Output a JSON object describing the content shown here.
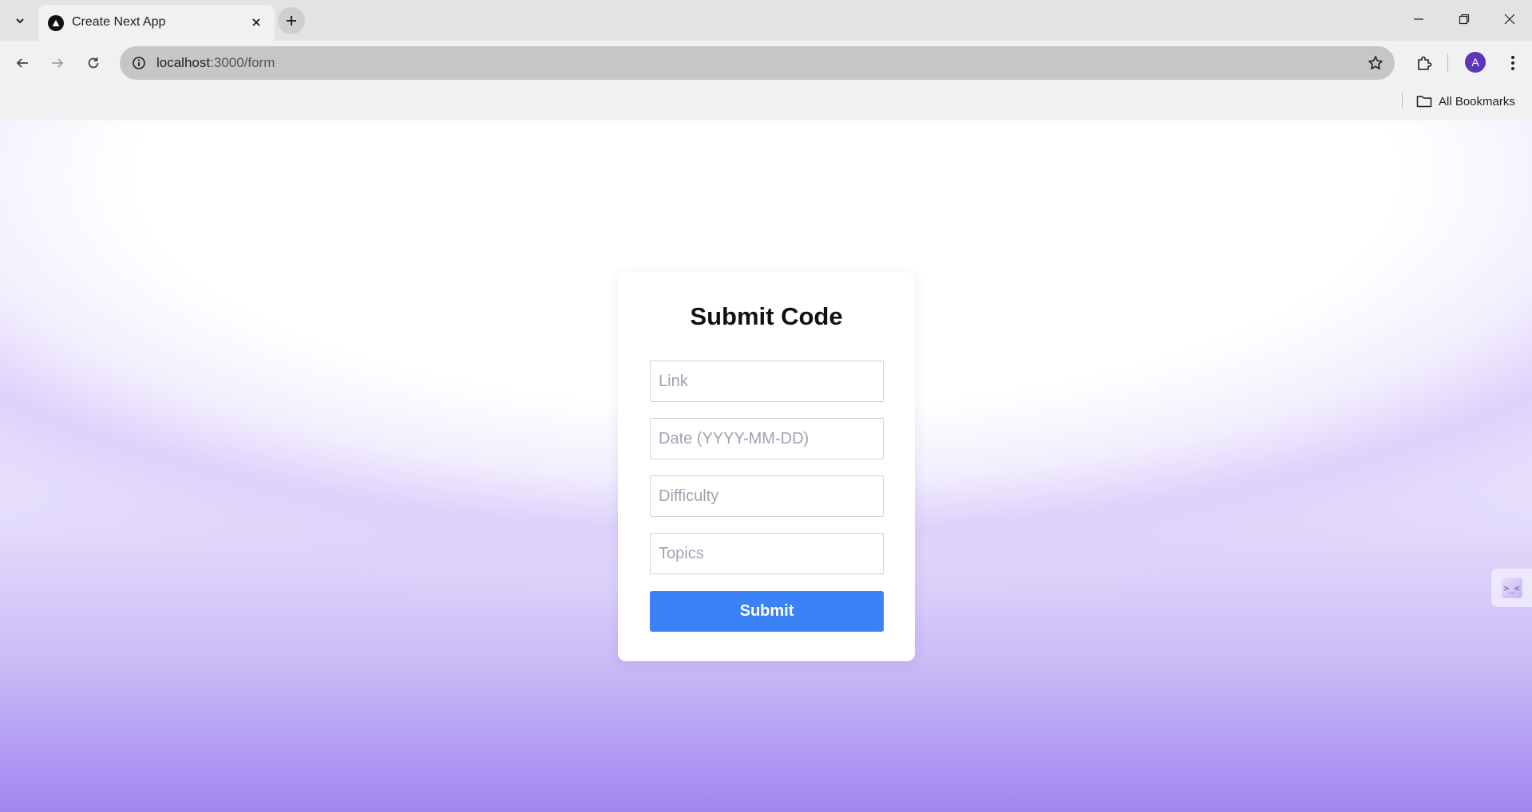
{
  "browser": {
    "tab_title": "Create Next App",
    "url_host": "localhost",
    "url_path": ":3000/form",
    "profile_initial": "A",
    "bookmarks_label": "All Bookmarks",
    "icons": {
      "tab_search": "chevron-down-icon",
      "favicon": "nextjs-triangle-icon",
      "tab_close": "close-icon",
      "new_tab": "plus-icon",
      "back": "arrow-left-icon",
      "forward": "arrow-right-icon",
      "reload": "reload-icon",
      "site_info": "info-icon",
      "bookmark": "star-icon",
      "extensions": "puzzle-icon",
      "menu": "kebab-menu-icon",
      "folder": "folder-icon",
      "minimize": "minimize-icon",
      "restore": "restore-icon",
      "close_window": "close-icon"
    }
  },
  "form": {
    "title": "Submit Code",
    "fields": [
      {
        "placeholder": "Link",
        "value": ""
      },
      {
        "placeholder": "Date (YYYY-MM-DD)",
        "value": ""
      },
      {
        "placeholder": "Difficulty",
        "value": ""
      },
      {
        "placeholder": "Topics",
        "value": ""
      }
    ],
    "submit_label": "Submit"
  },
  "side_widget": {
    "glyph": ">_<"
  },
  "colors": {
    "accent": "#3b82f6",
    "gradient_bottom": "#a186f0",
    "avatar": "#5c35b8"
  }
}
